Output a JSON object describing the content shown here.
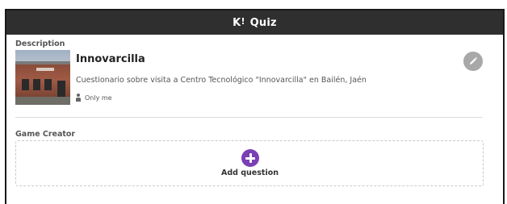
{
  "header": {
    "logo": "K",
    "logo_mark": "!",
    "title": "Quiz"
  },
  "description_section": {
    "label": "Description",
    "quiz_title": "Innovarcilla",
    "quiz_description": "Cuestionario sobre visita a Centro Tecnológico \"Innovarcilla\" en Bailén, Jaén",
    "visibility": "Only me",
    "visibility_icon": "user-icon",
    "edit_icon": "pencil-icon"
  },
  "game_creator": {
    "label": "Game Creator",
    "add_question_label": "Add question",
    "add_icon": "plus-icon",
    "accent_color": "#7b3fb4"
  },
  "colors": {
    "header_bg": "#2f2f2f",
    "edit_button": "#a8a8a8"
  }
}
